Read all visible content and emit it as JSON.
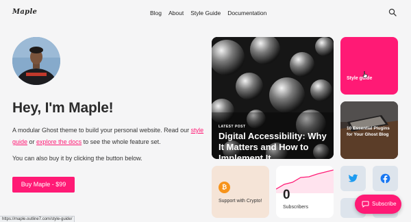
{
  "header": {
    "logo": "Maple",
    "nav": [
      "Blog",
      "About",
      "Style Guide",
      "Documentation"
    ]
  },
  "hero": {
    "title": "Hey, I'm Maple!",
    "desc_before": "A modular Ghost theme to build your personal website. Read our ",
    "link1": "style guide",
    "desc_middle": " or ",
    "link2": "explore the docs",
    "desc_after": " to see the whole feature set.",
    "note": "You can also buy it by clicking the button below.",
    "button": "Buy Maple - $99"
  },
  "cards": {
    "latest_label": "LATEST POST",
    "latest_title": "Digital Accessibility: Why It Matters and How to Implement It",
    "tag_label": "Style guide",
    "plugins_title": "10 Essential Plugins for Your Ghost Blog",
    "crypto_label": "Support with Crypto!",
    "subscriber_count": "0",
    "subscriber_label": "Subscribers"
  },
  "subscribe_button": "Subscribe",
  "status_url": "https://maple.outline7.com/style-guide/",
  "colors": {
    "accent": "#ff1a75",
    "page_bg": "#f5f5f6",
    "crypto_bg": "#f5e4d7",
    "social_bg": "#dde4ec",
    "twitter": "#1d9bf0",
    "facebook": "#1877f2"
  },
  "icons": {
    "search": "search-icon",
    "bitcoin": "bitcoin-icon",
    "twitter": "twitter-icon",
    "facebook": "facebook-icon",
    "subscribe": "subscribe-icon",
    "cursor": "hand-cursor-icon"
  }
}
